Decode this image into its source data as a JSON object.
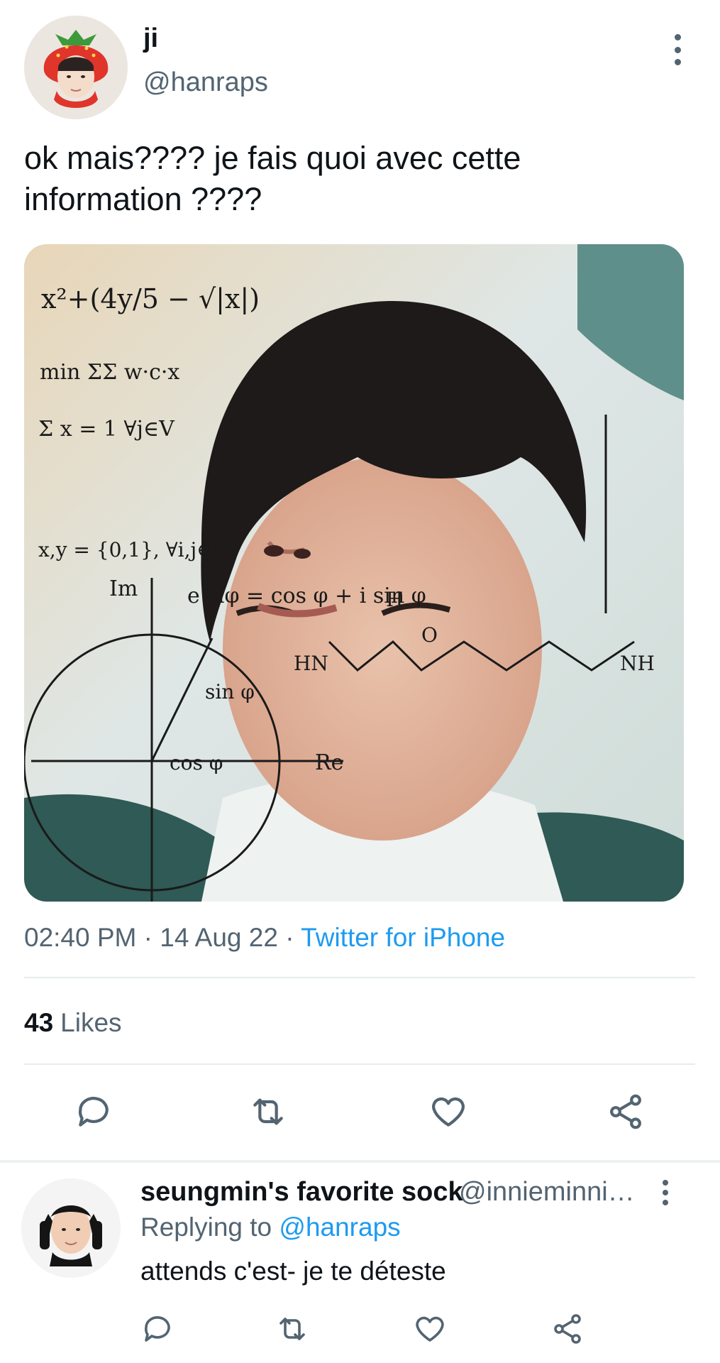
{
  "tweet": {
    "display_name": "ji",
    "handle": "@hanraps",
    "text": "ok mais???? je fais quoi avec cette information ????",
    "media_formulas": [
      "x²+(4y/5 − √|x|)",
      "min ΣΣ w·c·x",
      "Σ x = 1 ∀j∈V",
      "x,y = {0,1}, ∀i,j∈V",
      "e^iφ = cos φ + i sin φ",
      "Im",
      "Re",
      "sin φ",
      "cos φ",
      "HN",
      "NH",
      "H",
      "O"
    ],
    "time": "02:40 PM",
    "date": "14 Aug 22",
    "separator": "·",
    "source": "Twitter for iPhone",
    "likes_count": "43",
    "likes_label": "Likes",
    "actions": [
      "reply-icon",
      "retweet-icon",
      "like-icon",
      "share-icon"
    ]
  },
  "reply": {
    "display_name": "seungmin's favorite sock",
    "handle": "@innieminnie...",
    "replying_prefix": "Replying to",
    "replying_mention": "@hanraps",
    "text": "attends c'est- je te déteste",
    "actions": [
      "reply-icon",
      "retweet-icon",
      "like-icon",
      "share-icon"
    ]
  },
  "colors": {
    "text": "#0f1419",
    "secondary": "#536471",
    "accent": "#1d9bf0",
    "divider": "#e6ecf0"
  }
}
